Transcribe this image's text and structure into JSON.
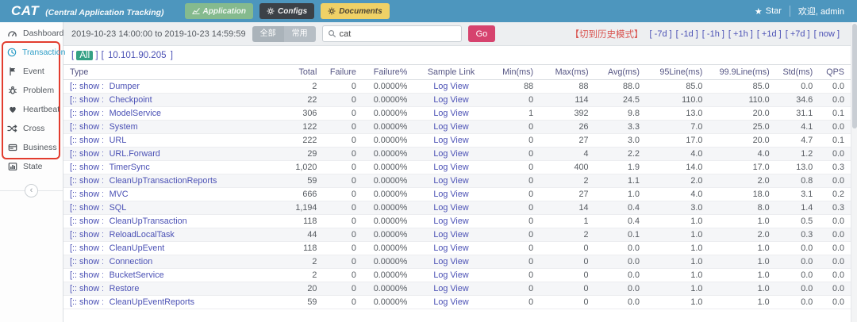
{
  "colors": {
    "header_bg": "#4d96be",
    "app_btn": "#85ba8e",
    "configs_btn": "#3b4147",
    "documents_btn": "#efd166",
    "go_btn": "#d6436e",
    "seg_btn": "#b6bec5",
    "seg_btn_active": "#aab3ba",
    "link": "#4b51b5",
    "history": "#d9534f",
    "annotation": "#e23c2e",
    "active": "#2e9ec7",
    "machine_sel": "#34a084",
    "th_color": "#565684"
  },
  "header": {
    "logo": "CAT",
    "subtitle": "(Central Application Tracking)",
    "nav": [
      {
        "label": "Application",
        "icon": "chart-icon",
        "cls": "nav-app"
      },
      {
        "label": "Configs",
        "icon": "gear-icon",
        "cls": "nav-cfg"
      },
      {
        "label": "Documents",
        "icon": "gear-icon",
        "cls": "nav-doc"
      }
    ],
    "star_label": "Star",
    "welcome": "欢迎, admin"
  },
  "sidebar": {
    "items": [
      {
        "label": "Dashboard",
        "icon": "gauge-icon",
        "active": false,
        "annotated": false
      },
      {
        "label": "Transaction",
        "icon": "clock-icon",
        "active": true,
        "annotated": true
      },
      {
        "label": "Event",
        "icon": "flag-icon",
        "active": false,
        "annotated": true
      },
      {
        "label": "Problem",
        "icon": "bug-icon",
        "active": false,
        "annotated": true
      },
      {
        "label": "Heartbeat",
        "icon": "heart-icon",
        "active": false,
        "annotated": true
      },
      {
        "label": "Cross",
        "icon": "shuffle-icon",
        "active": false,
        "annotated": true
      },
      {
        "label": "Business",
        "icon": "card-icon",
        "active": false,
        "annotated": true
      },
      {
        "label": "State",
        "icon": "bar-chart-icon",
        "active": false,
        "annotated": false
      }
    ]
  },
  "toolbar": {
    "date_range": "2019-10-23 14:00:00 to 2019-10-23 14:59:59",
    "filter_buttons": [
      "全部",
      "常用"
    ],
    "search_value": "cat",
    "go_label": "Go",
    "history_mode": "【切到历史模式】",
    "time_links": [
      "[ -7d ]",
      "[ -1d ]",
      "[ -1h ]",
      "[ +1h ]",
      "[ +1d ]",
      "[ +7d ]",
      "[ now ]"
    ]
  },
  "machines": {
    "items": [
      {
        "label": "All",
        "selected": true
      },
      {
        "label": "10.101.90.205",
        "selected": false
      }
    ]
  },
  "table": {
    "show_label": "[:: show ::]",
    "sample_link_label": "Log View",
    "columns": [
      "Type",
      "Total",
      "Failure",
      "Failure%",
      "Sample Link",
      "Min(ms)",
      "Max(ms)",
      "Avg(ms)",
      "95Line(ms)",
      "99.9Line(ms)",
      "Std(ms)",
      "QPS"
    ],
    "rows": [
      {
        "type": "Dumper",
        "total": "2",
        "failure": "0",
        "failure_pct": "0.0000%",
        "min": "88",
        "max": "88",
        "avg": "88.0",
        "p95": "85.0",
        "p999": "85.0",
        "std": "0.0",
        "qps": "0.0"
      },
      {
        "type": "Checkpoint",
        "total": "22",
        "failure": "0",
        "failure_pct": "0.0000%",
        "min": "0",
        "max": "114",
        "avg": "24.5",
        "p95": "110.0",
        "p999": "110.0",
        "std": "34.6",
        "qps": "0.0"
      },
      {
        "type": "ModelService",
        "total": "306",
        "failure": "0",
        "failure_pct": "0.0000%",
        "min": "1",
        "max": "392",
        "avg": "9.8",
        "p95": "13.0",
        "p999": "20.0",
        "std": "31.1",
        "qps": "0.1"
      },
      {
        "type": "System",
        "total": "122",
        "failure": "0",
        "failure_pct": "0.0000%",
        "min": "0",
        "max": "26",
        "avg": "3.3",
        "p95": "7.0",
        "p999": "25.0",
        "std": "4.1",
        "qps": "0.0"
      },
      {
        "type": "URL",
        "total": "222",
        "failure": "0",
        "failure_pct": "0.0000%",
        "min": "0",
        "max": "27",
        "avg": "3.0",
        "p95": "17.0",
        "p999": "20.0",
        "std": "4.7",
        "qps": "0.1"
      },
      {
        "type": "URL.Forward",
        "total": "29",
        "failure": "0",
        "failure_pct": "0.0000%",
        "min": "0",
        "max": "4",
        "avg": "2.2",
        "p95": "4.0",
        "p999": "4.0",
        "std": "1.2",
        "qps": "0.0"
      },
      {
        "type": "TimerSync",
        "total": "1,020",
        "failure": "0",
        "failure_pct": "0.0000%",
        "min": "0",
        "max": "400",
        "avg": "1.9",
        "p95": "14.0",
        "p999": "17.0",
        "std": "13.0",
        "qps": "0.3"
      },
      {
        "type": "CleanUpTransactionReports",
        "total": "59",
        "failure": "0",
        "failure_pct": "0.0000%",
        "min": "0",
        "max": "2",
        "avg": "1.1",
        "p95": "2.0",
        "p999": "2.0",
        "std": "0.8",
        "qps": "0.0"
      },
      {
        "type": "MVC",
        "total": "666",
        "failure": "0",
        "failure_pct": "0.0000%",
        "min": "0",
        "max": "27",
        "avg": "1.0",
        "p95": "4.0",
        "p999": "18.0",
        "std": "3.1",
        "qps": "0.2"
      },
      {
        "type": "SQL",
        "total": "1,194",
        "failure": "0",
        "failure_pct": "0.0000%",
        "min": "0",
        "max": "14",
        "avg": "0.4",
        "p95": "3.0",
        "p999": "8.0",
        "std": "1.4",
        "qps": "0.3"
      },
      {
        "type": "CleanUpTransaction",
        "total": "118",
        "failure": "0",
        "failure_pct": "0.0000%",
        "min": "0",
        "max": "1",
        "avg": "0.4",
        "p95": "1.0",
        "p999": "1.0",
        "std": "0.5",
        "qps": "0.0"
      },
      {
        "type": "ReloadLocalTask",
        "total": "44",
        "failure": "0",
        "failure_pct": "0.0000%",
        "min": "0",
        "max": "2",
        "avg": "0.1",
        "p95": "1.0",
        "p999": "2.0",
        "std": "0.3",
        "qps": "0.0"
      },
      {
        "type": "CleanUpEvent",
        "total": "118",
        "failure": "0",
        "failure_pct": "0.0000%",
        "min": "0",
        "max": "0",
        "avg": "0.0",
        "p95": "1.0",
        "p999": "1.0",
        "std": "0.0",
        "qps": "0.0"
      },
      {
        "type": "Connection",
        "total": "2",
        "failure": "0",
        "failure_pct": "0.0000%",
        "min": "0",
        "max": "0",
        "avg": "0.0",
        "p95": "1.0",
        "p999": "1.0",
        "std": "0.0",
        "qps": "0.0"
      },
      {
        "type": "BucketService",
        "total": "2",
        "failure": "0",
        "failure_pct": "0.0000%",
        "min": "0",
        "max": "0",
        "avg": "0.0",
        "p95": "1.0",
        "p999": "1.0",
        "std": "0.0",
        "qps": "0.0"
      },
      {
        "type": "Restore",
        "total": "20",
        "failure": "0",
        "failure_pct": "0.0000%",
        "min": "0",
        "max": "0",
        "avg": "0.0",
        "p95": "1.0",
        "p999": "1.0",
        "std": "0.0",
        "qps": "0.0"
      },
      {
        "type": "CleanUpEventReports",
        "total": "59",
        "failure": "0",
        "failure_pct": "0.0000%",
        "min": "0",
        "max": "0",
        "avg": "0.0",
        "p95": "1.0",
        "p999": "1.0",
        "std": "0.0",
        "qps": "0.0"
      }
    ]
  }
}
